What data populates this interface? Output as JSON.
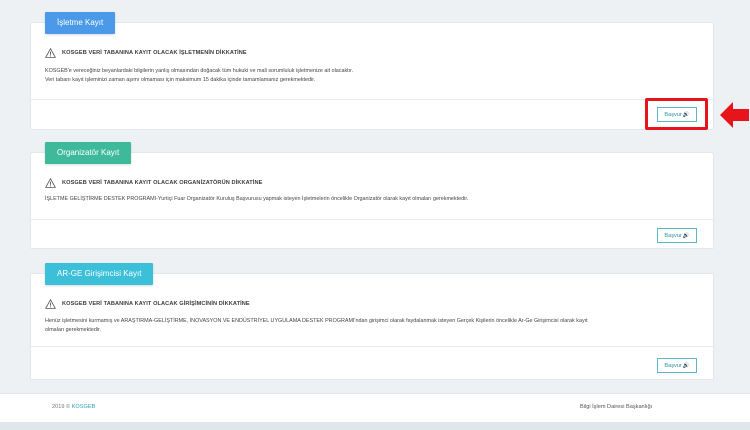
{
  "cards": [
    {
      "header": "İşletme Kayıt",
      "header_color": "#4a9ae9",
      "warning": "KOSGEB VERİ TABANINA KAYIT OLACAK İŞLETMENİN DİKKATİNE",
      "lines": [
        "KOSGEB'e vereceğiniz beyanlardaki bilgilerin yanlış olmasından doğacak tüm hukuki ve mali sorumluluk işletmenize ait olacaktır.",
        "Veri tabanı kayıt işleminizi zaman aşımı olmaması için maksimum 15 dakika içinde tamamlamanız gerekmektedir."
      ],
      "button": "Başvur"
    },
    {
      "header": "Organizatör Kayıt",
      "header_color": "#3fb99b",
      "warning": "KOSGEB VERİ TABANINA KAYIT OLACAK ORGANİZATÖRÜN DİKKATİNE",
      "lines": [
        "İŞLETME GELİŞTİRME DESTEK PROGRAMI-Yurtiçi Fuar Organizatör Kuruluş Başvurusu yapmak isteyen İşletmelerin öncelikle Organizatör olarak kayıt olmaları gerekmektedir."
      ],
      "button": "Başvur"
    },
    {
      "header": "AR-GE Girişimcisi Kayıt",
      "header_color": "#3cbfd9",
      "warning": "KOSGEB VERİ TABANINA KAYIT OLACAK GİRİŞİMCİNİN DİKKATİNE",
      "lines": [
        "Henüz işletmesini kurmamış ve ARAŞTIRMA-GELİŞTİRME, İNOVASYON VE ENDÜSTRİYEL UYGULAMA DESTEK PROGRAMI'ndan girişimci olarak faydalanmak isteyen Gerçek Kişilerin öncelikle Ar-Ge Girişimcisi olarak kayıt",
        "olmaları gerekmektedir."
      ],
      "button": "Başvur"
    }
  ],
  "footer": {
    "copyright": "2019 ©",
    "brand": "KOSGEB",
    "department": "Bilgi İşlem Dairesi Başkanlığı"
  },
  "icons": {
    "warning": "warning-triangle-icon",
    "button": "speaker-icon",
    "annotation": "red-arrow-left-icon"
  },
  "colors": {
    "highlight": "#e8141b",
    "button_border": "#5bb8c9"
  }
}
